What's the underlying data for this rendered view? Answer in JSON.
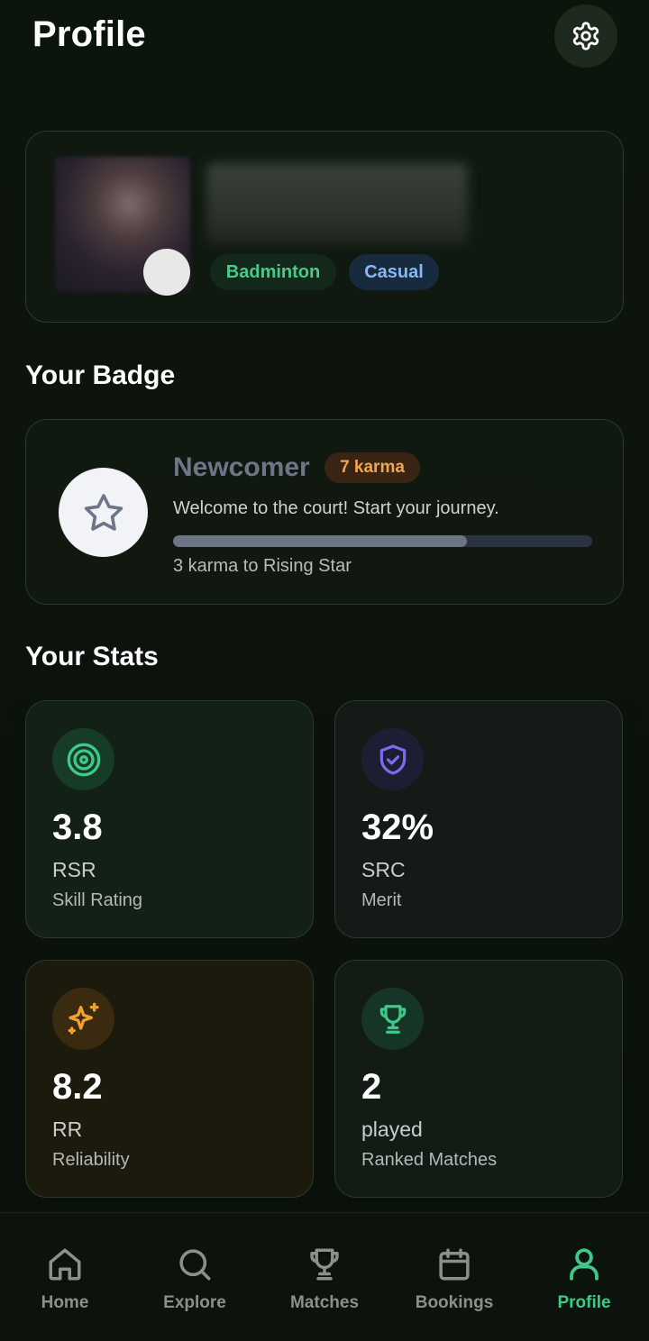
{
  "header": {
    "title": "Profile",
    "settings_icon": "gear-icon"
  },
  "profile": {
    "tags": [
      "Badminton",
      "Casual"
    ],
    "tag_colors": [
      "#4cc98a",
      "#8ab8f0"
    ]
  },
  "badge_section": {
    "title": "Your Badge",
    "badge": {
      "icon": "star-icon",
      "name": "Newcomer",
      "karma": "7 karma",
      "description": "Welcome to the court! Start your journey.",
      "progress": 0.7,
      "next_text": "3 karma to Rising Star"
    }
  },
  "stats_section": {
    "title": "Your Stats",
    "stats": [
      {
        "icon": "target-icon",
        "value": "3.8",
        "code": "RSR",
        "label": "Skill Rating",
        "accent": "#3ec98a"
      },
      {
        "icon": "shield-check-icon",
        "value": "32%",
        "code": "SRC",
        "label": "Merit",
        "accent": "#7b6cf0"
      },
      {
        "icon": "sparkles-icon",
        "value": "8.2",
        "code": "RR",
        "label": "Reliability",
        "accent": "#f0a030"
      },
      {
        "icon": "trophy-icon",
        "value": "2",
        "code": "played",
        "label": "Ranked Matches",
        "accent": "#3ec98a"
      }
    ]
  },
  "nav": {
    "items": [
      {
        "label": "Home",
        "icon": "home-icon",
        "active": false
      },
      {
        "label": "Explore",
        "icon": "search-icon",
        "active": false
      },
      {
        "label": "Matches",
        "icon": "trophy-icon",
        "active": false
      },
      {
        "label": "Bookings",
        "icon": "calendar-icon",
        "active": false
      },
      {
        "label": "Profile",
        "icon": "user-icon",
        "active": true
      }
    ],
    "active_color": "#3ec98a",
    "inactive_color": "#8a918a"
  }
}
